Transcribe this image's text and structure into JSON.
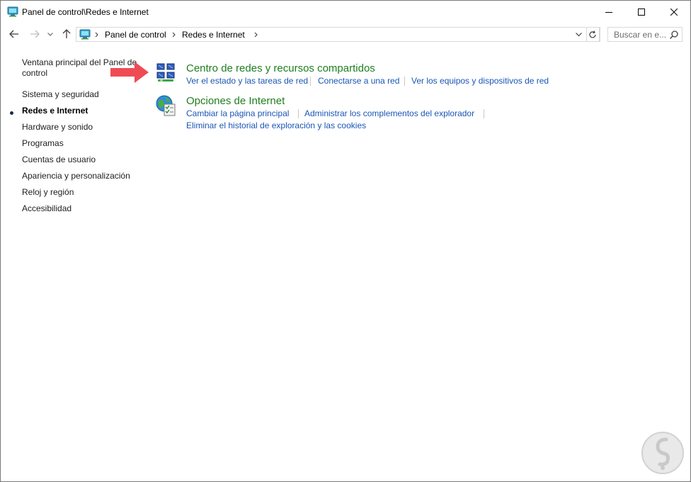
{
  "window": {
    "title": "Panel de control\\Redes e Internet"
  },
  "address": {
    "crumbs": [
      "Panel de control",
      "Redes e Internet"
    ]
  },
  "search": {
    "placeholder": "Buscar en e..."
  },
  "sidebar": {
    "items": [
      {
        "label_line1": "Ventana principal del Panel de",
        "label_line2": "control"
      },
      {
        "label": "Sistema y seguridad"
      },
      {
        "label": "Redes e Internet",
        "active": true
      },
      {
        "label": "Hardware y sonido"
      },
      {
        "label": "Programas"
      },
      {
        "label": "Cuentas de usuario"
      },
      {
        "label": "Apariencia y personalización"
      },
      {
        "label": "Reloj y región"
      },
      {
        "label": "Accesibilidad"
      }
    ]
  },
  "categories": [
    {
      "title": "Centro de redes y recursos compartidos",
      "icon": "network-center-icon",
      "links": [
        "Ver el estado y las tareas de red",
        "Conectarse a una red",
        "Ver los equipos y dispositivos de red"
      ]
    },
    {
      "title": "Opciones de Internet",
      "icon": "internet-options-icon",
      "links": [
        "Cambiar la página principal",
        "Administrar los complementos del explorador",
        "Eliminar el historial de exploración y las cookies"
      ]
    }
  ],
  "colors": {
    "category_title": "#1e7f1e",
    "link": "#1a56b5",
    "annotation_arrow": "#ef4b55"
  }
}
